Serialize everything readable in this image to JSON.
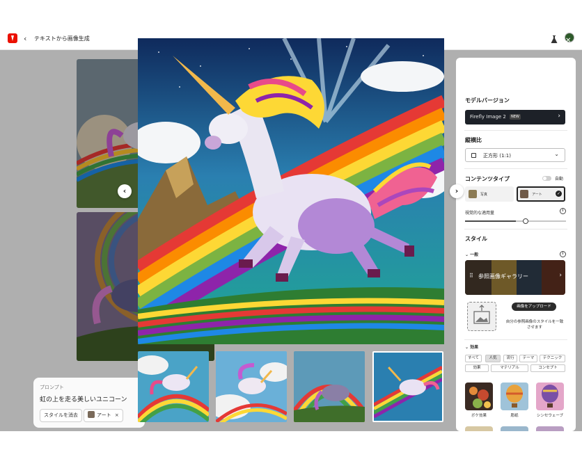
{
  "header": {
    "breadcrumb": "テキストから画像生成",
    "back_icon": "chevron-left-icon",
    "app_icon": "adobe-logo",
    "lab_icon": "flask-icon",
    "avatar_icon": "avatar"
  },
  "prompt": {
    "label": "プロンプト",
    "text": "虹の上を走る美しいユニコーン",
    "clear_style_label": "スタイルを消去",
    "style_chip_label": "アート",
    "style_chip_close": "×"
  },
  "panel": {
    "model_version": {
      "title": "モデルバージョン",
      "value": "Firefly Image 2",
      "badge": "NEW"
    },
    "aspect_ratio": {
      "title": "縦横比",
      "value": "正方形 (1:1)"
    },
    "content_type": {
      "title": "コンテンツタイプ",
      "auto_label": "自動",
      "options": [
        "写真",
        "アート"
      ],
      "selected": "アート"
    },
    "visual_intensity": {
      "label": "視覚的な適用量",
      "value": 0.5
    },
    "style": {
      "title": "スタイル",
      "section_general": "一般",
      "gallery_label": "参照画像ギャラリー",
      "upload_button": "画像をアップロード",
      "upload_desc": "自分の参照画像のスタイルを一致させます"
    },
    "effects": {
      "title": "効果",
      "filters_row1": [
        "すべて",
        "人気",
        "流行",
        "テーマ",
        "テクニック"
      ],
      "filters_row2": [
        "効果",
        "マテリアル",
        "コンセプト"
      ],
      "active_filter": "人気",
      "items": [
        "ボケ効果",
        "彫紙",
        "シンセウェーブ"
      ]
    }
  },
  "modal": {
    "prev_icon": "chevron-left-icon",
    "next_icon": "chevron-right-icon",
    "close_icon": "close-icon",
    "thumbnails_count": 4,
    "selected_index": 4
  },
  "colors": {
    "accent": "#eb1000",
    "panel_bg": "#ffffff",
    "overlay": "#000000"
  }
}
